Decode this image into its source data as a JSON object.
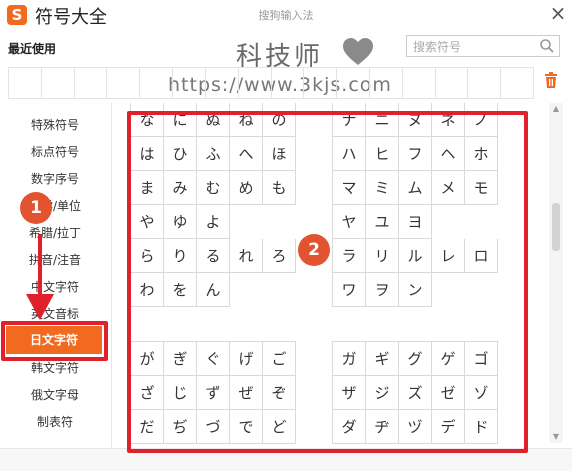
{
  "app": {
    "logo_letter": "S",
    "title": "符号大全",
    "center_title": "搜狗输入法",
    "close_glyph": "×"
  },
  "recent": {
    "label": "最近使用"
  },
  "search": {
    "placeholder": "搜索符号"
  },
  "watermark": {
    "title": "科技师",
    "url": "https://www.3kjs.com"
  },
  "sidebar": {
    "items": [
      {
        "label": "特殊符号"
      },
      {
        "label": "标点符号"
      },
      {
        "label": "数字序号"
      },
      {
        "label": "数学/单位"
      },
      {
        "label": "希腊/拉丁"
      },
      {
        "label": "拼音/注音"
      },
      {
        "label": "中文字符"
      },
      {
        "label": "英文音标"
      },
      {
        "label": "日文字符"
      },
      {
        "label": "韩文字符"
      },
      {
        "label": "俄文字母"
      },
      {
        "label": "制表符"
      }
    ],
    "active_index": 8
  },
  "kana": {
    "hiragana_top": [
      [
        "な",
        "に",
        "ぬ",
        "ね",
        "の"
      ],
      [
        "は",
        "ひ",
        "ふ",
        "へ",
        "ほ"
      ],
      [
        "ま",
        "み",
        "む",
        "め",
        "も"
      ],
      [
        "や",
        "ゆ",
        "よ",
        "",
        ""
      ],
      [
        "ら",
        "り",
        "る",
        "れ",
        "ろ"
      ],
      [
        "わ",
        "を",
        "ん",
        "",
        ""
      ]
    ],
    "katakana_top": [
      [
        "ナ",
        "ニ",
        "ヌ",
        "ネ",
        "ノ"
      ],
      [
        "ハ",
        "ヒ",
        "フ",
        "ヘ",
        "ホ"
      ],
      [
        "マ",
        "ミ",
        "ム",
        "メ",
        "モ"
      ],
      [
        "ヤ",
        "ユ",
        "ヨ",
        "",
        ""
      ],
      [
        "ラ",
        "リ",
        "ル",
        "レ",
        "ロ"
      ],
      [
        "ワ",
        "ヲ",
        "ン",
        "",
        ""
      ]
    ],
    "hiragana_bottom": [
      [
        "が",
        "ぎ",
        "ぐ",
        "げ",
        "ご"
      ],
      [
        "ざ",
        "じ",
        "ず",
        "ぜ",
        "ぞ"
      ],
      [
        "だ",
        "ぢ",
        "づ",
        "で",
        "ど"
      ]
    ],
    "katakana_bottom": [
      [
        "ガ",
        "ギ",
        "グ",
        "ゲ",
        "ゴ"
      ],
      [
        "ザ",
        "ジ",
        "ズ",
        "ゼ",
        "ゾ"
      ],
      [
        "ダ",
        "ヂ",
        "ヅ",
        "デ",
        "ド"
      ]
    ]
  },
  "annotations": {
    "step1": "1",
    "step2": "2",
    "color": "#e0202a"
  },
  "colors": {
    "accent": "#f26a20",
    "annotation_red": "#e0202a"
  },
  "icons": {
    "search": "search-icon",
    "trash": "trash-icon",
    "heart": "heart-icon",
    "close": "close-icon"
  }
}
